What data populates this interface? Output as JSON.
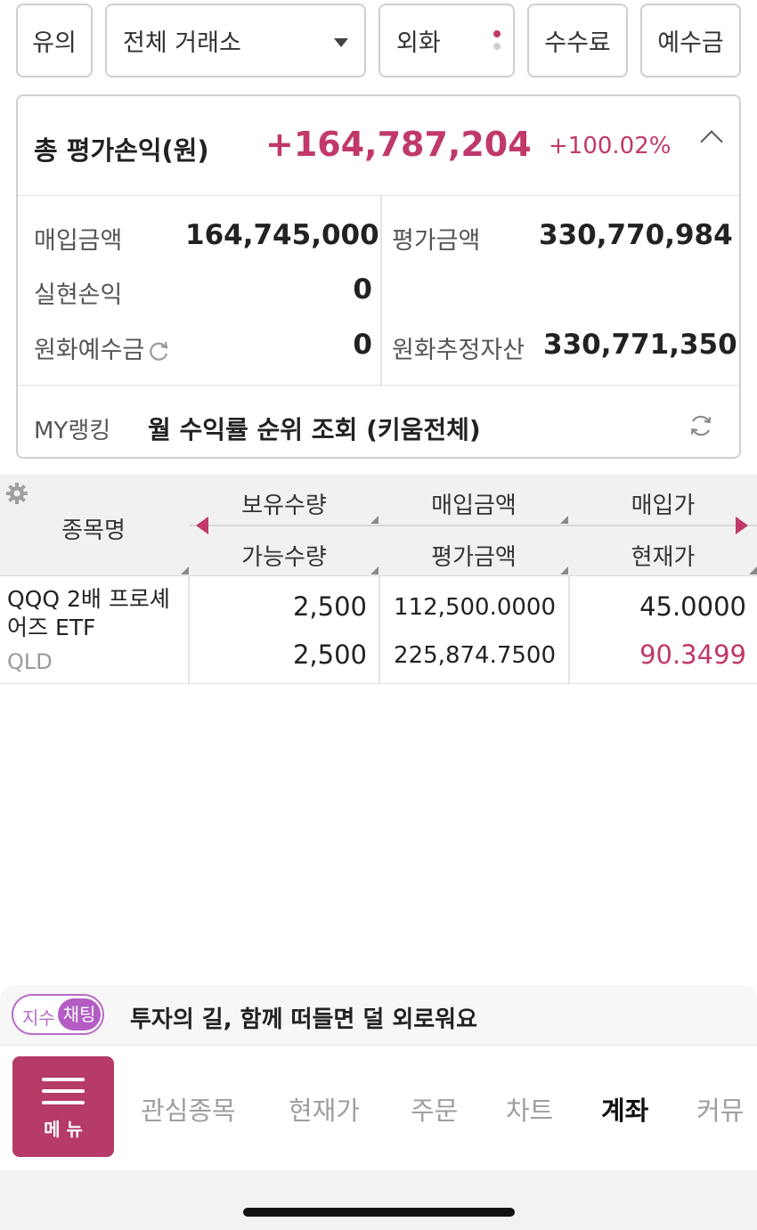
{
  "toolbar": {
    "caution_label": "유의",
    "exchange_select": "전체 거래소",
    "fx_label": "외화",
    "fee_label": "수수료",
    "deposit_label": "예수금"
  },
  "summary": {
    "title": "총 평가손익(원)",
    "total_pl": "+164,787,204",
    "total_pl_rate": "+100.02%",
    "purchase_label": "매입금액",
    "purchase_value": "164,745,000",
    "eval_label": "평가금액",
    "eval_value": "330,770,984",
    "realized_label": "실현손익",
    "realized_value": "0",
    "krw_deposit_label": "원화예수금",
    "krw_deposit_value": "0",
    "krw_est_assets_label": "원화추정자산",
    "krw_est_assets_value": "330,771,350"
  },
  "ranking": {
    "label": "MY랭킹",
    "text": "월 수익률 순위 조회 (키움전체)"
  },
  "table": {
    "headers": {
      "name": "종목명",
      "holding_qty": "보유수량",
      "available_qty": "가능수량",
      "purchase_amount": "매입금액",
      "eval_amount": "평가금액",
      "purchase_price": "매입가",
      "current_price": "현재가"
    },
    "rows": [
      {
        "name": "QQQ 2배 프로셰어즈 ETF",
        "ticker": "QLD",
        "holding_qty": "2,500",
        "available_qty": "2,500",
        "purchase_amount": "112,500.0000",
        "eval_amount": "225,874.7500",
        "purchase_price": "45.0000",
        "current_price": "90.3499"
      }
    ]
  },
  "chat": {
    "tag_index": "지수",
    "tag_chat": "채팅",
    "message": "투자의 길, 함께 떠들면 덜 외로워요"
  },
  "nav": {
    "menu_label": "메 뉴",
    "items": [
      "관심종목",
      "현재가",
      "주문",
      "차트",
      "계좌",
      "커뮤"
    ],
    "active_index": 4
  },
  "colors": {
    "accent": "#c0396a",
    "menu_bg": "#b63b68",
    "chat_tag": "#b25cc4"
  }
}
